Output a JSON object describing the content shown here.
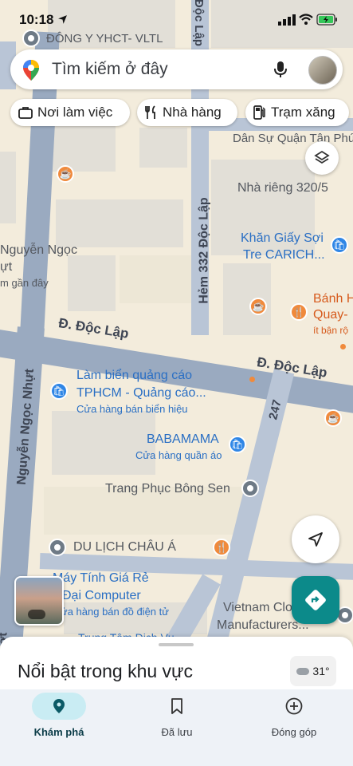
{
  "status_bar": {
    "time": "10:18"
  },
  "search": {
    "placeholder": "Tìm kiếm ở đây"
  },
  "chips": [
    {
      "label": "Nơi làm việc",
      "icon": "briefcase-icon"
    },
    {
      "label": "Nhà hàng",
      "icon": "fork-knife-icon"
    },
    {
      "label": "Trạm xăng",
      "icon": "fuel-pump-icon"
    }
  ],
  "map": {
    "streets": {
      "doc_lap_1": "Đ. Độc Lập",
      "doc_lap_2": "Đ. Độc Lập",
      "hem_332": "Hẻm 332 Độc Lập",
      "nguyen_ngoc_nhut": "Nguyễn Ngọc Nhựt",
      "doc_lap_vertical": "Độc Lập",
      "road_247": "247"
    },
    "places": {
      "dong_y": "ĐÔNG Y YHCT- VLTL",
      "dan_su": "Dân Sự Quận Tân Phú",
      "nha_rieng": "Nhà riêng 320/5",
      "nguyen_ngoc": "Nguyễn Ngọc",
      "nguyen_ngoc_2": "ựt",
      "gan_day": "m gần đây",
      "khan_giay": "Khăn Giấy Sợi",
      "khan_giay_2": "Tre CARICH...",
      "banh": "Bánh H",
      "banh_2": "Quay-",
      "banh_3": "ít bận rộ",
      "lam_bien": "Làm biển quảng cáo",
      "lam_bien_2": "TPHCM - Quảng cáo...",
      "lam_bien_sub": "Cửa hàng bán biển hiệu",
      "babamama": "BABAMAMA",
      "babamama_sub": "Cửa hàng quần áo",
      "trang_phuc": "Trang Phục Bông Sen",
      "du_lich": "DU LỊCH CHÂU Á",
      "may_tinh": "Máy Tính Giá Rẻ",
      "may_tinh_2": "Đại Computer",
      "may_tinh_sub": "ửa hàng bán đồ điện tử",
      "vietnam": "Vietnam Clo",
      "vietnam_2": "Manufacturers...",
      "trung_tam": "Trung Tâm Dịch Vụ",
      "left_edge": "ớt"
    }
  },
  "sheet": {
    "title": "Nổi bật trong khu vực",
    "weather": "31°"
  },
  "nav": [
    {
      "label": "Khám phá",
      "icon": "explore-pin-icon",
      "active": true
    },
    {
      "label": "Đã lưu",
      "icon": "bookmark-icon",
      "active": false
    },
    {
      "label": "Đóng góp",
      "icon": "add-circle-icon",
      "active": false
    }
  ],
  "colors": {
    "accent": "#1a7f8e",
    "fab_directions": "#0c8a8a",
    "road": "#9aaac0"
  }
}
